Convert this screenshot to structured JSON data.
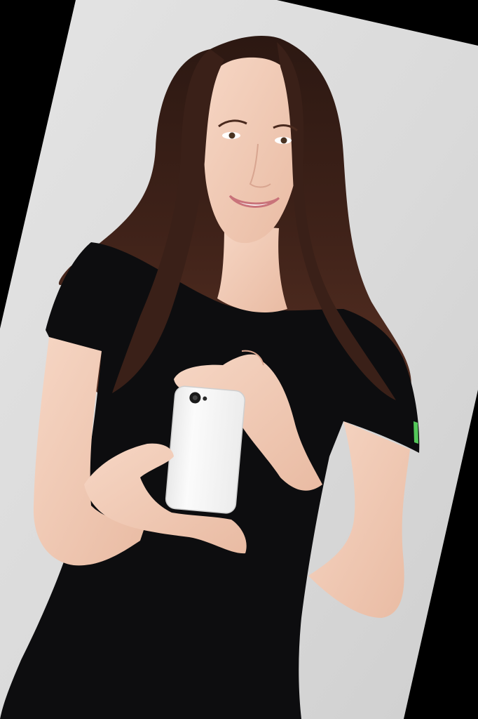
{
  "image": {
    "background_color": "#000000",
    "backdrop_color": "#dcdcdc",
    "subject": {
      "hair_color": "#3a2018",
      "shirt_color": "#0d0d0f",
      "skin_color": "#f0c9b4",
      "phone_color": "#f6f6f6",
      "sleeve_accent_color": "#54c85a"
    }
  }
}
